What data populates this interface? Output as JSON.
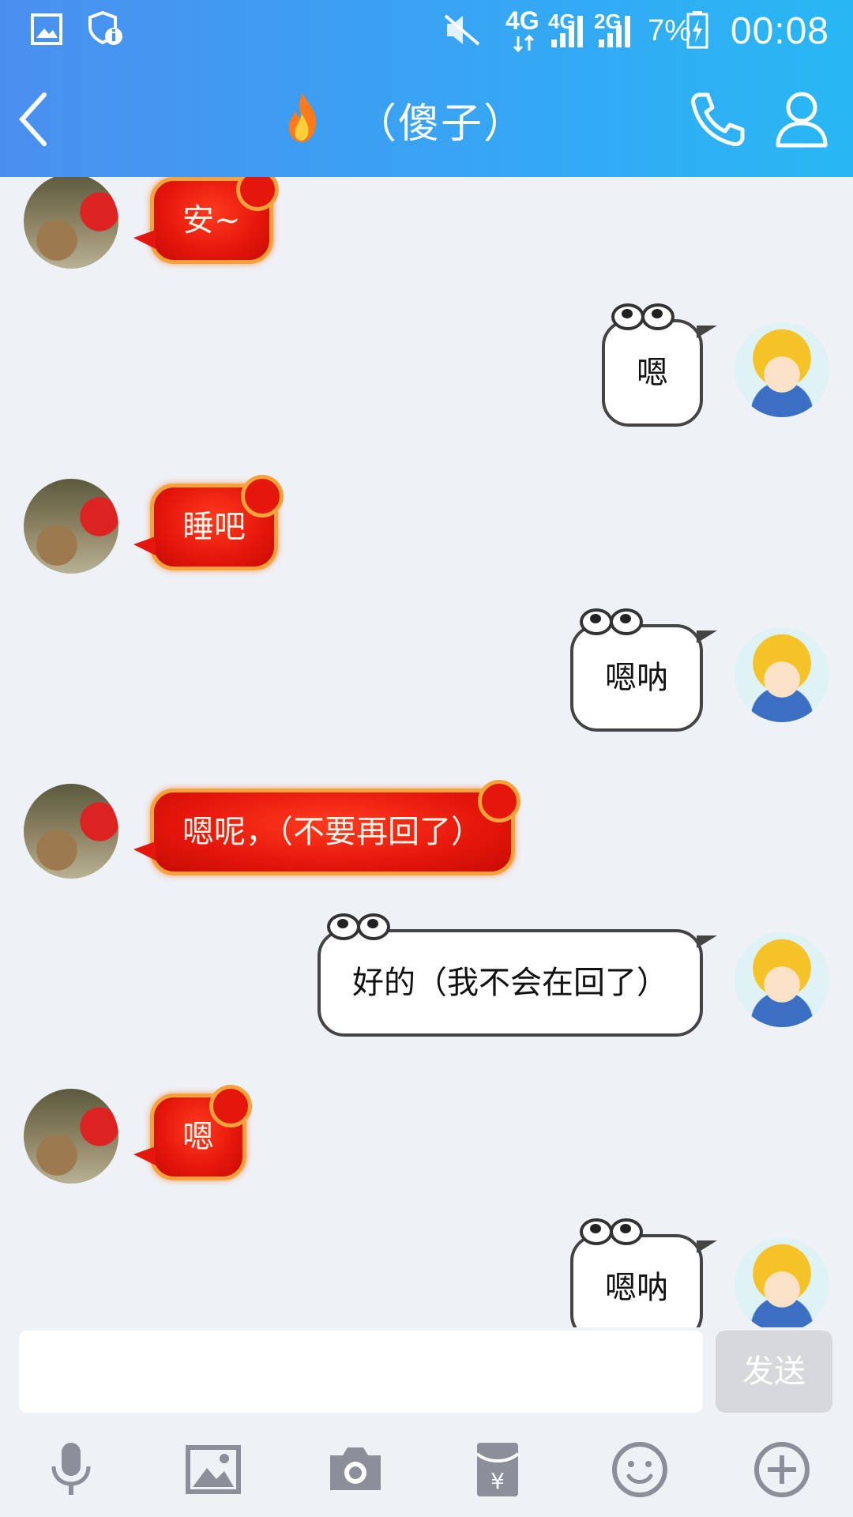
{
  "status_bar": {
    "network_top": "4G",
    "network_mid1": "4G",
    "network_mid2": "2G",
    "battery": "7%",
    "time": "00:08"
  },
  "header": {
    "title": "（傻子）",
    "back_icon": "chevron-left-icon",
    "call_icon": "phone-icon",
    "profile_icon": "user-icon"
  },
  "messages": [
    {
      "side": "left",
      "text": "安~"
    },
    {
      "side": "right",
      "text": "嗯"
    },
    {
      "side": "left",
      "text": "睡吧"
    },
    {
      "side": "right",
      "text": "嗯呐"
    },
    {
      "side": "left",
      "text": "嗯呢，（不要再回了）"
    },
    {
      "side": "right",
      "text": "好的（我不会在回了）"
    },
    {
      "side": "left",
      "text": "嗯"
    },
    {
      "side": "right",
      "text": "嗯呐"
    }
  ],
  "composer": {
    "value": "",
    "send_label": "发送"
  },
  "toolbar": {
    "items": [
      "microphone-icon",
      "image-icon",
      "camera-icon",
      "red-packet-icon",
      "emoji-icon",
      "plus-icon"
    ]
  },
  "colors": {
    "header_start": "#4a8ff0",
    "header_end": "#28b7f5",
    "chat_bg": "#eef1f6",
    "left_bubble": "#e5160b",
    "right_bubble": "#ffffff",
    "send_button": "#d6d8dc"
  }
}
